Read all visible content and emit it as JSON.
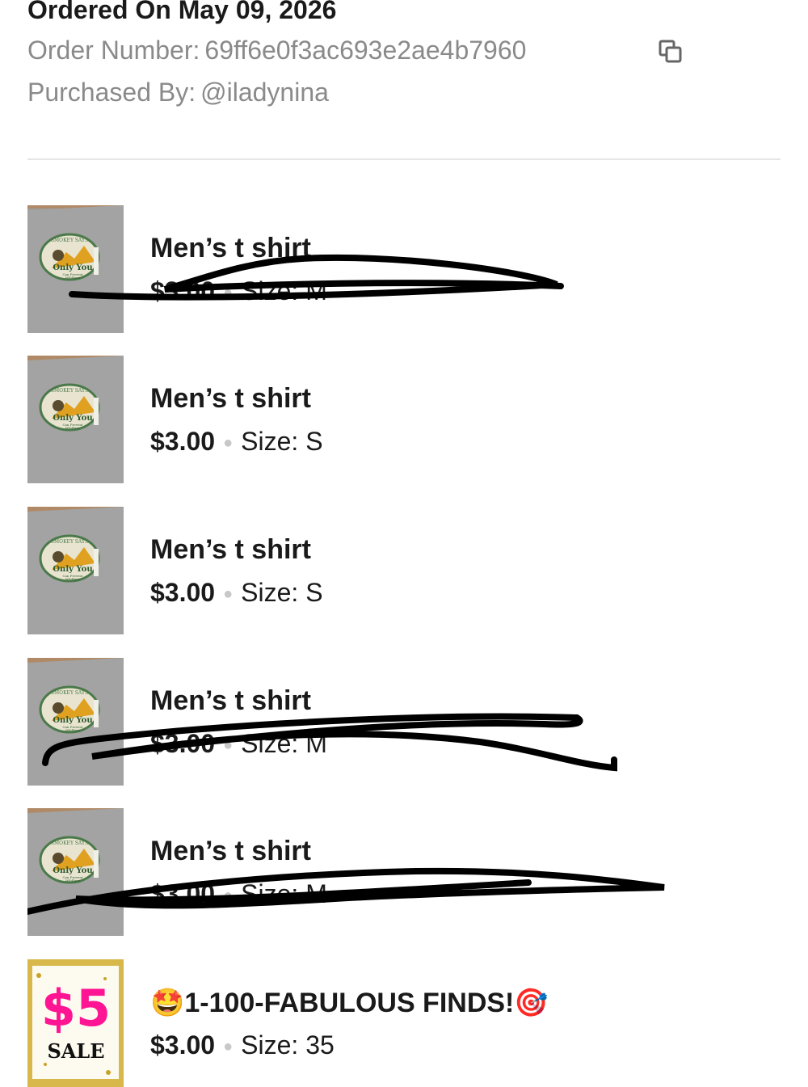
{
  "order": {
    "ordered_on": "Ordered On May 09, 2026",
    "order_number_label": "Order Number:",
    "order_number": "69ff6e0f3ac693e2ae4b7960",
    "purchased_by_label": "Purchased By:",
    "purchased_by": "@iladynina"
  },
  "thumb_text": {
    "brand": "SMOKEY SAYS",
    "slogan": "Only You",
    "slogan_sub": "Can Prevent",
    "slogan_sub2": "Wildfires",
    "sale_price": "$5",
    "sale_word": "SALE"
  },
  "items": [
    {
      "title": "Men’s t shirt",
      "price": "$3.00",
      "size_label": "Size:",
      "size": "M",
      "scribbled": true
    },
    {
      "title": "Men’s t shirt",
      "price": "$3.00",
      "size_label": "Size:",
      "size": "S",
      "scribbled": false
    },
    {
      "title": "Men’s t shirt",
      "price": "$3.00",
      "size_label": "Size:",
      "size": "S",
      "scribbled": false
    },
    {
      "title": "Men’s t shirt",
      "price": "$3.00",
      "size_label": "Size:",
      "size": "M",
      "scribbled": true
    },
    {
      "title": "Men’s t shirt",
      "price": "$3.00",
      "size_label": "Size:",
      "size": "M",
      "scribbled": true
    },
    {
      "title": "🤩1-100-FABULOUS FINDS!🎯",
      "price": "$3.00",
      "size_label": "Size:",
      "size": "35",
      "scribbled": false
    }
  ],
  "icons": {
    "copy": "copy-icon"
  },
  "colors": {
    "sale_pink": "#ff1493",
    "muted_text": "#8a8a8a",
    "scribble": "#000000"
  }
}
